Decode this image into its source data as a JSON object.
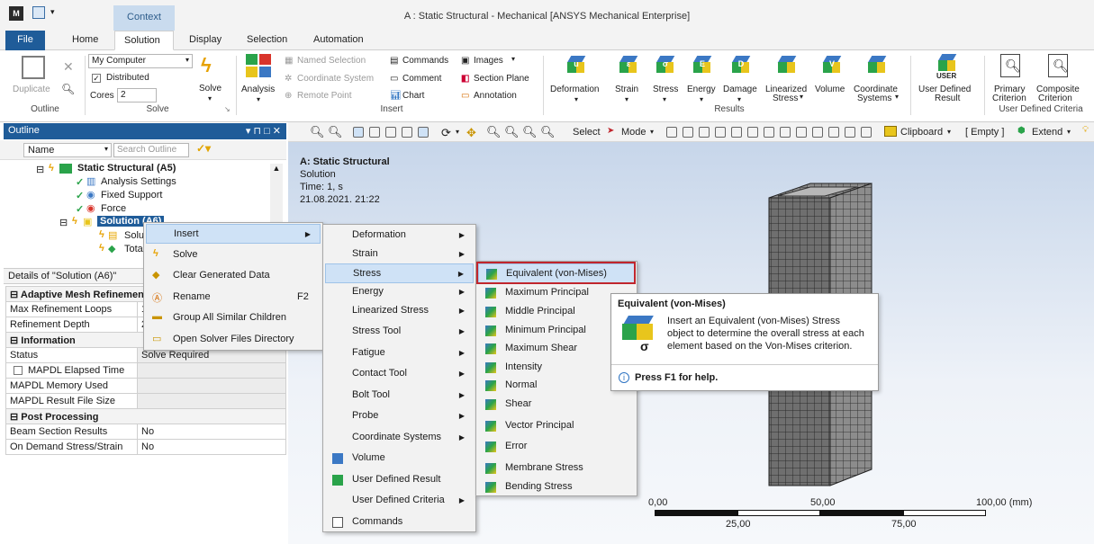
{
  "window": {
    "title": "A : Static Structural - Mechanical [ANSYS Mechanical Enterprise]",
    "logo": "M",
    "context_tab": "Context"
  },
  "menu": {
    "file": "File",
    "home": "Home",
    "solution": "Solution",
    "display": "Display",
    "selection": "Selection",
    "automation": "Automation"
  },
  "ribbon": {
    "outline": {
      "duplicate": "Duplicate",
      "label": "Outline"
    },
    "solve": {
      "computer": "My Computer",
      "distributed": "Distributed",
      "cores_label": "Cores",
      "cores_value": "2",
      "solve_btn": "Solve",
      "label": "Solve"
    },
    "insert": {
      "analysis": "Analysis",
      "named_selection": "Named Selection",
      "coordinate_system": "Coordinate System",
      "remote_point": "Remote Point",
      "commands": "Commands",
      "comment": "Comment",
      "chart": "Chart",
      "images": "Images",
      "section_plane": "Section Plane",
      "annotation": "Annotation",
      "label": "Insert"
    },
    "results": {
      "deformation": "Deformation",
      "strain": "Strain",
      "stress": "Stress",
      "energy": "Energy",
      "damage": "Damage",
      "linearized_1": "Linearized",
      "linearized_2": "Stress",
      "volume": "Volume",
      "coordinate_1": "Coordinate",
      "coordinate_2": "Systems",
      "label": "Results",
      "icon_letters": [
        "u",
        "ε",
        "σ",
        "E",
        "D",
        "",
        "V",
        ""
      ]
    },
    "user_defined": {
      "user_badge": "USER",
      "udr_1": "User Defined",
      "udr_2": "Result",
      "primary_1": "Primary",
      "primary_2": "Criterion",
      "composite_1": "Composite",
      "composite_2": "Criterion",
      "label": "User Defined Criteria"
    }
  },
  "outline": {
    "title": "Outline",
    "pin_controls": "▾ ⊓ □ ✕",
    "name_col": "Name",
    "search_placeholder": "Search Outline",
    "tree": {
      "static": "Static Structural (A5)",
      "analysis_settings": "Analysis Settings",
      "fixed_support": "Fixed Support",
      "force": "Force",
      "solution": "Solution (A6)",
      "solution_info": "Solu",
      "total": "Tota"
    }
  },
  "details": {
    "title": "Details of \"Solution (A6)\"",
    "sections": {
      "adaptive": "Adaptive Mesh Refinement",
      "information": "Information",
      "post": "Post Processing"
    },
    "rows": {
      "max_loops": "Max Refinement Loops",
      "max_loops_val": "1",
      "depth": "Refinement Depth",
      "depth_val": "2",
      "status": "Status",
      "status_val": "Solve Required",
      "elapsed": "MAPDL Elapsed Time",
      "memory": "MAPDL Memory Used",
      "result_size": "MAPDL Result File Size",
      "beam": "Beam Section Results",
      "beam_val": "No",
      "on_demand": "On Demand Stress/Strain",
      "on_demand_val": "No"
    }
  },
  "graphics_toolbar": {
    "select": "Select",
    "mode": "Mode",
    "clipboard": "Clipboard",
    "empty": "[ Empty ]",
    "extend": "Extend"
  },
  "viewport": {
    "heading": "A: Static Structural",
    "sub": "Solution",
    "time": "Time: 1, s",
    "date": "21.08.2021. 21:22",
    "scale": {
      "t0": "0,00",
      "t1": "50,00",
      "t2": "100,00 (mm)",
      "b1": "25,00",
      "b2": "75,00"
    }
  },
  "context_menu": {
    "insert": "Insert",
    "solve": "Solve",
    "clear": "Clear Generated Data",
    "rename": "Rename",
    "rename_key": "F2",
    "group": "Group All Similar Children",
    "open_dir": "Open Solver Files Directory"
  },
  "insert_menu": {
    "deformation": "Deformation",
    "strain": "Strain",
    "stress": "Stress",
    "energy": "Energy",
    "linearized": "Linearized Stress",
    "stress_tool": "Stress Tool",
    "fatigue": "Fatigue",
    "contact_tool": "Contact Tool",
    "bolt_tool": "Bolt Tool",
    "probe": "Probe",
    "coord_sys": "Coordinate Systems",
    "volume": "Volume",
    "udr": "User Defined Result",
    "udc": "User Defined Criteria",
    "commands": "Commands"
  },
  "stress_menu": {
    "equivalent": "Equivalent (von-Mises)",
    "max_principal": "Maximum Principal",
    "mid_principal": "Middle Principal",
    "min_principal": "Minimum Principal",
    "max_shear": "Maximum Shear",
    "intensity": "Intensity",
    "normal": "Normal",
    "shear": "Shear",
    "vector": "Vector Principal",
    "error": "Error",
    "membrane": "Membrane Stress",
    "bending": "Bending Stress"
  },
  "tooltip": {
    "title": "Equivalent (von-Mises)",
    "line1": "Insert an Equivalent (von-Mises) Stress",
    "line2": "object to determine the overall stress at each",
    "line3": "element based on the Von-Mises criterion.",
    "help": "Press F1 for help."
  }
}
